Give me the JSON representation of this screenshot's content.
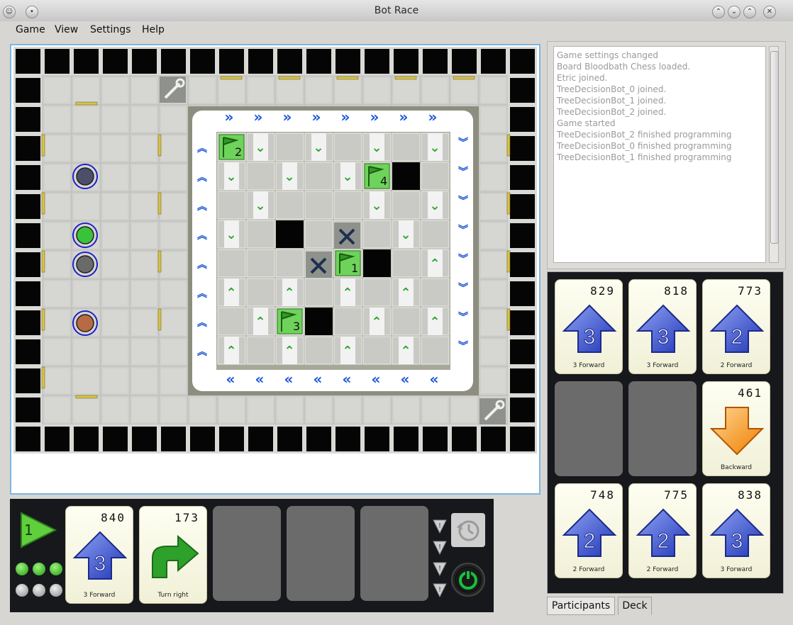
{
  "window": {
    "title": "Bot Race"
  },
  "menu": {
    "game": "Game",
    "view": "View",
    "settings": "Settings",
    "help": "Help"
  },
  "log": {
    "lines": [
      "Game settings changed",
      "Board Bloodbath Chess loaded.",
      "Etric joined.",
      "TreeDecisionBot_0 joined.",
      "TreeDecisionBot_1 joined.",
      "TreeDecisionBot_2 joined.",
      "Game started",
      "TreeDecisionBot_2 finished programming",
      "TreeDecisionBot_0 finished programming",
      "TreeDecisionBot_1 finished programming"
    ]
  },
  "board": {
    "flags": [
      "1",
      "2",
      "3",
      "4"
    ]
  },
  "deck": {
    "cards": [
      {
        "priority": "829",
        "label": "3 Forward",
        "icon": "forward-arrow",
        "number": "3"
      },
      {
        "priority": "818",
        "label": "3 Forward",
        "icon": "forward-arrow",
        "number": "3"
      },
      {
        "priority": "773",
        "label": "2 Forward",
        "icon": "forward-arrow",
        "number": "2"
      },
      {
        "priority": "461",
        "label": "Backward",
        "icon": "backward-arrow",
        "number": ""
      },
      {
        "priority": "748",
        "label": "2 Forward",
        "icon": "forward-arrow",
        "number": "2"
      },
      {
        "priority": "775",
        "label": "2 Forward",
        "icon": "forward-arrow",
        "number": "2"
      },
      {
        "priority": "838",
        "label": "3 Forward",
        "icon": "forward-arrow",
        "number": "3"
      }
    ]
  },
  "program": {
    "flag_number": "1",
    "cards": [
      {
        "priority": "840",
        "label": "3 Forward",
        "icon": "forward-arrow",
        "number": "3"
      },
      {
        "priority": "173",
        "label": "Turn right",
        "icon": "turn-right-arrow",
        "number": ""
      }
    ]
  },
  "tabs": {
    "participants": "Participants",
    "deck": "Deck"
  }
}
